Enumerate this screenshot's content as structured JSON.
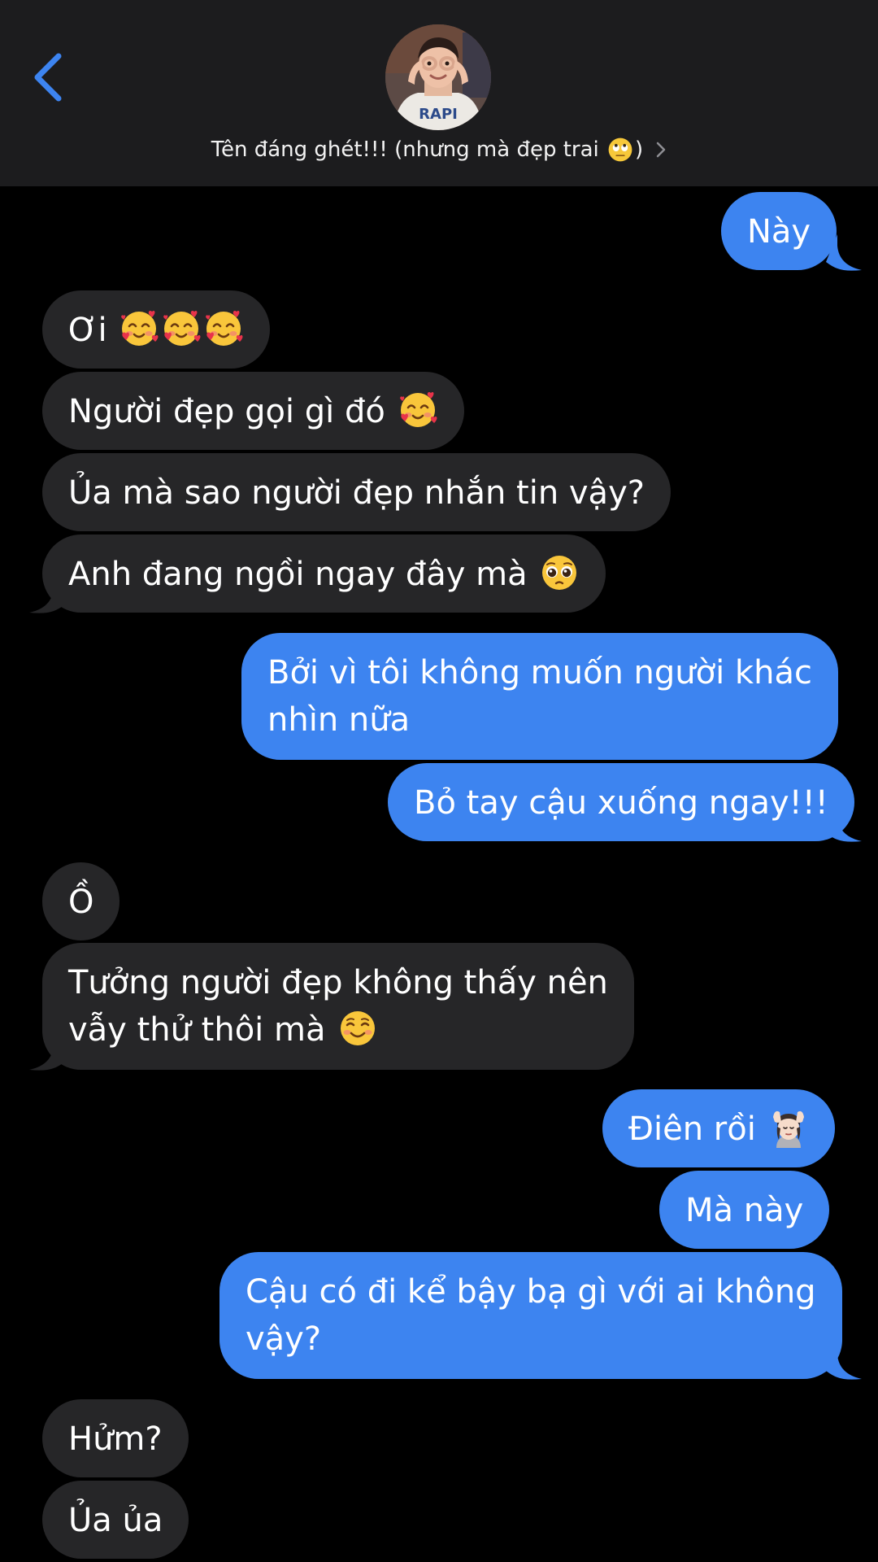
{
  "header": {
    "contact_name": "Tên đáng ghét!!! (nhưng mà đẹp trai",
    "contact_name_close": ")",
    "contact_emoji": "face-with-rolling-eyes",
    "avatar_shirt_text": "RAPI",
    "colors": {
      "background": "#1c1c1e",
      "accent": "#3d84f0"
    }
  },
  "messages": [
    {
      "from": "me",
      "text": "Này"
    },
    {
      "from": "them",
      "text": "Ơi",
      "emoji": [
        "smiling-face-with-hearts",
        "smiling-face-with-hearts",
        "smiling-face-with-hearts"
      ]
    },
    {
      "from": "them",
      "text": "Người đẹp gọi gì đó",
      "emoji": [
        "smiling-face-with-hearts"
      ]
    },
    {
      "from": "them",
      "text": "Ủa mà sao người đẹp nhắn tin vậy?"
    },
    {
      "from": "them",
      "text": "Anh đang ngồi ngay đây mà",
      "emoji": [
        "pleading-face"
      ]
    },
    {
      "from": "me",
      "lines": [
        "Bởi vì tôi không muốn người khác",
        "nhìn nữa"
      ]
    },
    {
      "from": "me",
      "text": "Bỏ tay cậu xuống ngay!!!"
    },
    {
      "from": "them",
      "text": "Ồ"
    },
    {
      "from": "them",
      "lines": [
        "Tưởng người đẹp không thấy nên",
        "vẫy thử thôi mà"
      ],
      "emoji": [
        "smiling-face"
      ]
    },
    {
      "from": "me",
      "text": "Điên rồi",
      "emoji": [
        "woman-getting-face-massage"
      ]
    },
    {
      "from": "me",
      "text": "Mà này"
    },
    {
      "from": "me",
      "lines": [
        "Cậu có đi kể bậy bạ gì với ai không",
        "vậy?"
      ]
    },
    {
      "from": "them",
      "text": "Hửm?"
    },
    {
      "from": "them",
      "text": "Ủa ủa"
    }
  ],
  "colors": {
    "outgoing_bubble": "#3d84f0",
    "incoming_bubble": "#262628",
    "text": "#ffffff",
    "background": "#000000"
  }
}
